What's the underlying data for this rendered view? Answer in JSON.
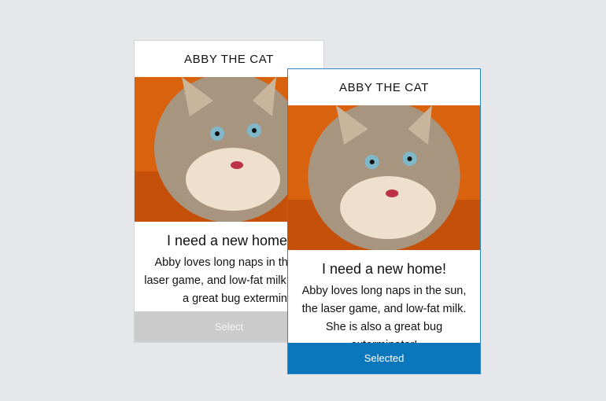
{
  "cards": [
    {
      "header": "ABBY THE CAT",
      "title": "I need a new home!",
      "description": "Abby loves long naps in the sun, the laser game, and low-fat milk. She is also a great bug exterminator!",
      "button": "Select",
      "state": "unselected"
    },
    {
      "header": "ABBY THE CAT",
      "title": "I need a new home!",
      "description": "Abby loves long naps in the sun, the laser game, and low-fat milk. She is also a great bug exterminator!",
      "button": "Selected",
      "state": "selected"
    }
  ],
  "colors": {
    "selected": "#0a77bd",
    "unselected": "#cbcbcb",
    "background": "#e6e7ea"
  }
}
